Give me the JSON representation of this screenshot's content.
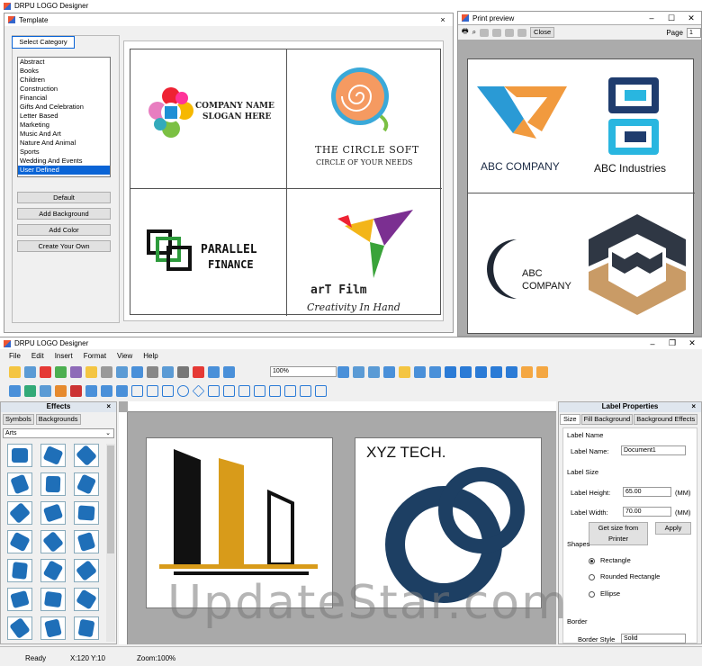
{
  "top_app": {
    "title": "DRPU LOGO Designer"
  },
  "template_dialog": {
    "title": "Template",
    "close": "×",
    "select_category": "Select Category",
    "categories": [
      "Abstract",
      "Books",
      "Children",
      "Construction",
      "Financial",
      "Gifts And Celebration",
      "Letter Based",
      "Marketing",
      "Music And Art",
      "Nature And Animal",
      "Sports",
      "Wedding And Events",
      "User Defined"
    ],
    "buttons": [
      "Default",
      "Add Background",
      "Add Color",
      "Create Your Own"
    ],
    "cells": {
      "c1_line1": "COMPANY NAME",
      "c1_line2": "SLOGAN HERE",
      "c2_line1": "THE CIRCLE SOFT",
      "c2_line2": "CIRCLE OF YOUR NEEDS",
      "c3_line1": "PARALLEL",
      "c3_line2": "FINANCE",
      "c4_line1": "arT Film",
      "c4_line2": "Creativity In Hand"
    }
  },
  "print_preview": {
    "title": "Print preview",
    "close_btn": "Close",
    "page_label": "Page",
    "page_value": "1",
    "logos": {
      "l1": "ABC COMPANY",
      "l2": "ABC Industries",
      "l3_line1": "ABC",
      "l3_line2": "COMPANY"
    }
  },
  "main_app": {
    "title": "DRPU LOGO Designer",
    "menu": [
      "File",
      "Edit",
      "Insert",
      "Format",
      "View",
      "Help"
    ],
    "zoom": "100%",
    "effects": {
      "title": "Effects",
      "close": "×",
      "tabs": [
        "Symbols",
        "Backgrounds"
      ],
      "category": "Arts"
    },
    "canvas": {
      "right_title": "XYZ TECH."
    },
    "props": {
      "title": "Label Properties",
      "close": "×",
      "tabs": [
        "Size",
        "Fill Background",
        "Background Effects"
      ],
      "label_name_section": "Label Name",
      "label_name_label": "Label Name:",
      "label_name_value": "Document1",
      "label_size_section": "Label Size",
      "height_label": "Label Height:",
      "height_value": "65.00",
      "width_label": "Label Width:",
      "width_value": "70.00",
      "unit": "(MM)",
      "get_size_btn": "Get size from Printer",
      "apply_btn": "Apply",
      "shapes_section": "Shapes",
      "shapes": [
        "Rectangle",
        "Rounded Rectangle",
        "Ellipse"
      ],
      "border_section": "Border",
      "border_style_label": "Border Style",
      "border_style_value": "Solid"
    },
    "status": {
      "ready": "Ready",
      "coords": "X:120  Y:10",
      "zoom": "Zoom:100%"
    }
  },
  "watermark": "UpdateStar.com",
  "colors": {
    "accent": "#0a64d6",
    "navy": "#1d3f63",
    "gold": "#d89b1a",
    "teal": "#2a9ad5"
  }
}
